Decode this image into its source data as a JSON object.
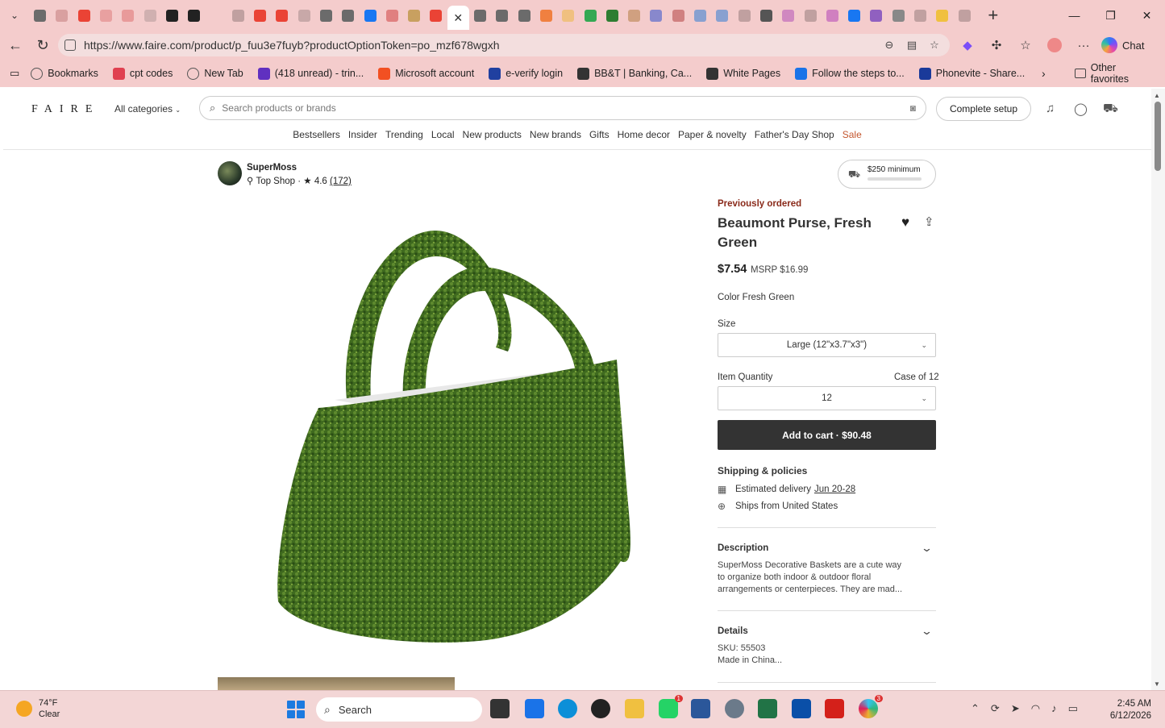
{
  "browser": {
    "tab_colors": [
      "#6b6b6b",
      "#d9a0a0",
      "#ea4335",
      "#e8a0a0",
      "#e89a9a",
      "#d0b0b0",
      "#222222",
      "#222222",
      "#f4cccc",
      "#c0a0a0",
      "#ea4335",
      "#ea4335",
      "#c8a8a8",
      "#6b6b6b",
      "#6b6b6b",
      "#1877f2",
      "#e08080",
      "#c8a060",
      "#ea4335",
      "#ffffff",
      "#6b6b6b",
      "#6b6b6b",
      "#6b6b6b",
      "#f08040",
      "#f0c080",
      "#34a853",
      "#2e7d32",
      "#d0a080",
      "#8888cc",
      "#d08080",
      "#88a0d0",
      "#88a0d0",
      "#c0a0a0",
      "#555555",
      "#d088c0",
      "#c0a0a0",
      "#d080c0",
      "#1877f2",
      "#9060c0",
      "#888888",
      "#c0a0a0",
      "#f0c040",
      "#c0a0a0"
    ],
    "url": "https://www.faire.com/product/p_fuu3e7fuyb?productOptionToken=po_mzf678wgxh",
    "chat_label": "Chat",
    "bookmarks": [
      {
        "label": "Bookmarks",
        "color": "#555555"
      },
      {
        "label": "cpt codes",
        "color": "#e04050"
      },
      {
        "label": "New Tab",
        "color": "#555555"
      },
      {
        "label": "(418 unread) - trin...",
        "color": "#6030c0"
      },
      {
        "label": "Microsoft account",
        "color": "#f25022"
      },
      {
        "label": "e-verify login",
        "color": "#2040a0"
      },
      {
        "label": "BB&T | Banking, Ca...",
        "color": "#333333"
      },
      {
        "label": "White Pages",
        "color": "#333333"
      },
      {
        "label": "Follow the steps to...",
        "color": "#1a73e8"
      },
      {
        "label": "Phonevite - Share...",
        "color": "#1a3a9a"
      }
    ],
    "other_favorites": "Other favorites"
  },
  "site": {
    "logo": "FAIRE",
    "all_categories": "All categories",
    "search_placeholder": "Search products or brands",
    "complete_setup": "Complete setup",
    "nav": [
      "Bestsellers",
      "Insider",
      "Trending",
      "Local",
      "New products",
      "New brands",
      "Gifts",
      "Home decor",
      "Paper & novelty",
      "Father's Day Shop",
      "Sale"
    ]
  },
  "brand": {
    "name": "SuperMoss",
    "badge": "Top Shop",
    "separator": "·",
    "rating": "4.6",
    "reviews": "(172)",
    "minimum": "$250 minimum"
  },
  "product": {
    "status": "Previously ordered",
    "title": "Beaumont Purse, Fresh Green",
    "price": "$7.54",
    "msrp": "MSRP $16.99",
    "color": "Color Fresh Green",
    "size_label": "Size",
    "size_value": "Large (12\"x3.7\"x3\")",
    "qty_label": "Item Quantity",
    "qty_case": "Case of 12",
    "qty_value": "12",
    "add_to_cart": "Add to cart · $90.48",
    "shipping_title": "Shipping & policies",
    "est_delivery_label": "Estimated delivery",
    "est_delivery_date": "Jun 20-28",
    "ships_from": "Ships from United States",
    "description_title": "Description",
    "description_text": "SuperMoss Decorative Baskets are a cute way to organize both indoor & outdoor floral arrangements or centerpieces. They are mad...",
    "details_title": "Details",
    "sku": "SKU: 55503",
    "made_in": "Made in China..."
  },
  "taskbar": {
    "temp": "74°F",
    "condition": "Clear",
    "search": "Search",
    "time": "2:45 AM",
    "date": "6/12/2026",
    "whatsapp_badge": "1",
    "slack_badge": "3"
  }
}
